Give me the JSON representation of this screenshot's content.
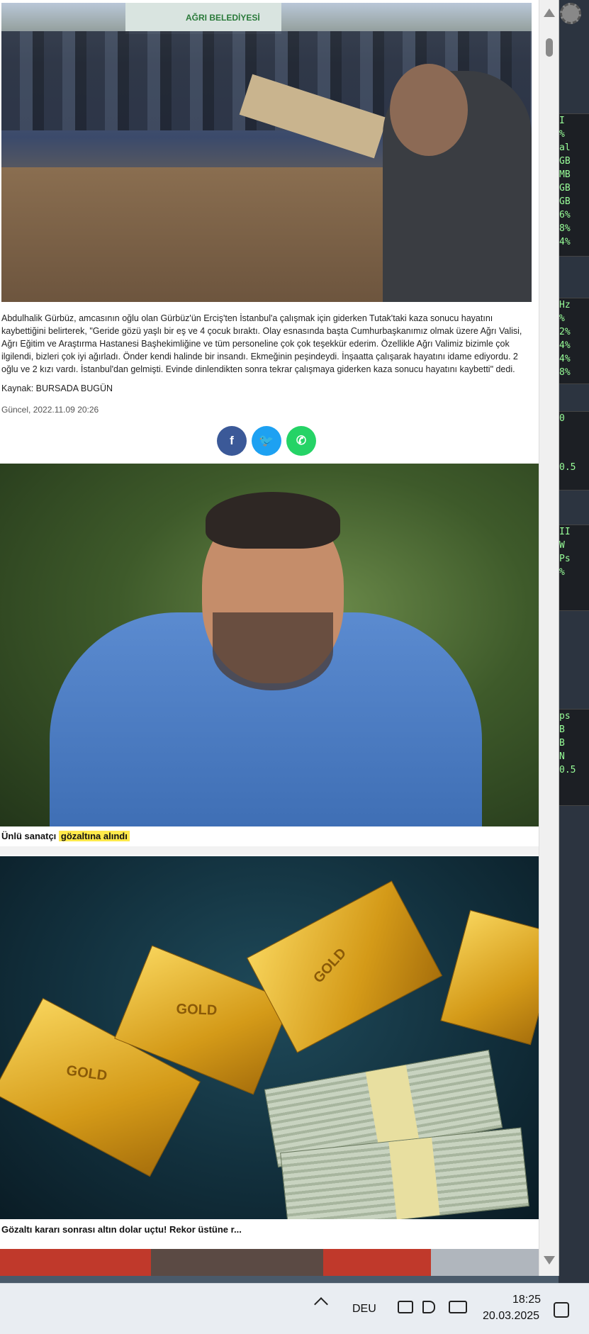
{
  "article": {
    "photo1_van_text": "AĞRI BELEDİYESİ",
    "body_text": "Abdulhalik Gürbüz, amcasının oğlu olan Gürbüz'ün Erciş'ten İstanbul'a çalışmak için giderken Tutak'taki kaza sonucu hayatını kaybettiğini belirterek, \"Geride gözü yaşlı bir eş ve 4 çocuk bıraktı. Olay esnasında başta Cumhurbaşkanımız olmak üzere Ağrı Valisi, Ağrı Eğitim ve Araştırma Hastanesi Başhekimliğine ve tüm personeline çok çok teşekkür ederim. Özellikle Ağrı Valimiz bizimle çok ilgilendi, bizleri çok iyi ağırladı. Önder kendi halinde bir insandı. Ekmeğinin peşindeydi. İnşaatta çalışarak hayatını idame ediyordu. 2 oğlu ve 2 kızı vardı. İstanbul'dan gelmişti. Evinde dinlendikten sonra tekrar çalışmaya giderken kaza sonucu hayatını kaybetti\" dedi.",
    "source": "Kaynak: BURSADA BUGÜN",
    "updated": "Güncel, 2022.11.09 20:26"
  },
  "share": {
    "facebook": "f",
    "twitter": "🐦",
    "whatsapp": "✆"
  },
  "related": [
    {
      "caption_prefix": "Ünlü sanatçı ",
      "caption_highlight": "gözaltına alındı"
    },
    {
      "caption": "Gözaltı kararı sonrası altın dolar uçtu! Rekor üstüne r..."
    }
  ],
  "gold_bar_text": "GOLD",
  "taskbar": {
    "language": "DEU",
    "time": "18:25",
    "date": "20.03.2025"
  },
  "widgets": {
    "w1": [
      "I",
      "%",
      "al",
      "GB",
      "MB",
      "GB",
      "GB",
      "6%",
      "8%",
      "4%"
    ],
    "w2": [
      "Hz",
      "%",
      "2%",
      "4%",
      "4%",
      "8%"
    ],
    "w3": [
      "0",
      "0.5"
    ],
    "w4": [
      "II",
      "W",
      "Ps",
      "%"
    ],
    "w5": [
      "ps",
      "B",
      "B",
      "N",
      "0.5"
    ]
  },
  "colors": {
    "facebook": "#3b5998",
    "twitter": "#1da1f2",
    "whatsapp": "#25d366",
    "highlight": "#ffe94a"
  }
}
